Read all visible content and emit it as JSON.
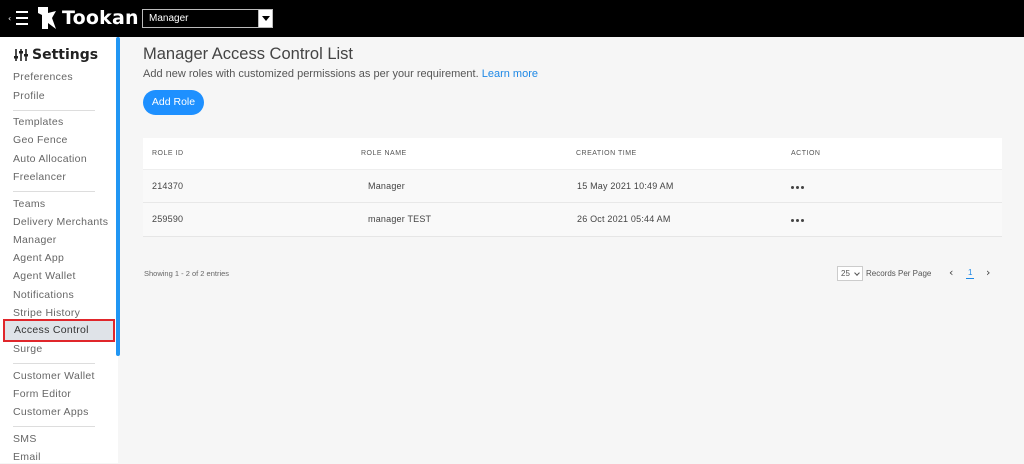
{
  "topbar": {
    "logo_text": "Tookan",
    "role_select_value": "Manager"
  },
  "sidebar": {
    "title": "Settings",
    "groups": [
      [
        "Preferences",
        "Profile"
      ],
      [
        "Templates",
        "Geo Fence",
        "Auto Allocation",
        "Freelancer"
      ],
      [
        "Teams",
        "Delivery Merchants",
        "Manager",
        "Agent App",
        "Agent Wallet",
        "Notifications",
        "Stripe History",
        "Access Control",
        "Surge"
      ],
      [
        "Customer Wallet",
        "Form Editor",
        "Customer Apps"
      ],
      [
        "SMS",
        "Email"
      ]
    ],
    "active_item": "Access Control"
  },
  "main": {
    "title": "Manager Access Control List",
    "subtitle": "Add new roles with customized permissions as per your requirement.",
    "learn_more": "Learn more",
    "add_button": "Add Role",
    "table": {
      "headers": [
        "ROLE ID",
        "ROLE NAME",
        "CREATION TIME",
        "ACTION"
      ],
      "rows": [
        {
          "role_id": "214370",
          "role_name": "Manager",
          "creation_time": "15 May 2021 10:49 AM"
        },
        {
          "role_id": "259590",
          "role_name": "manager TEST",
          "creation_time": "26 Oct 2021 05:44 AM"
        }
      ]
    },
    "pagination": {
      "showing": "Showing 1 - 2 of 2 entries",
      "per_page_value": "25",
      "per_page_label": "Records Per Page",
      "current_page": "1",
      "prev_icon": "chevron-left-icon",
      "next_icon": "chevron-right-icon"
    }
  },
  "colors": {
    "accent": "#1e90ff",
    "highlight_border": "#e0262b",
    "topbar": "#000000"
  }
}
